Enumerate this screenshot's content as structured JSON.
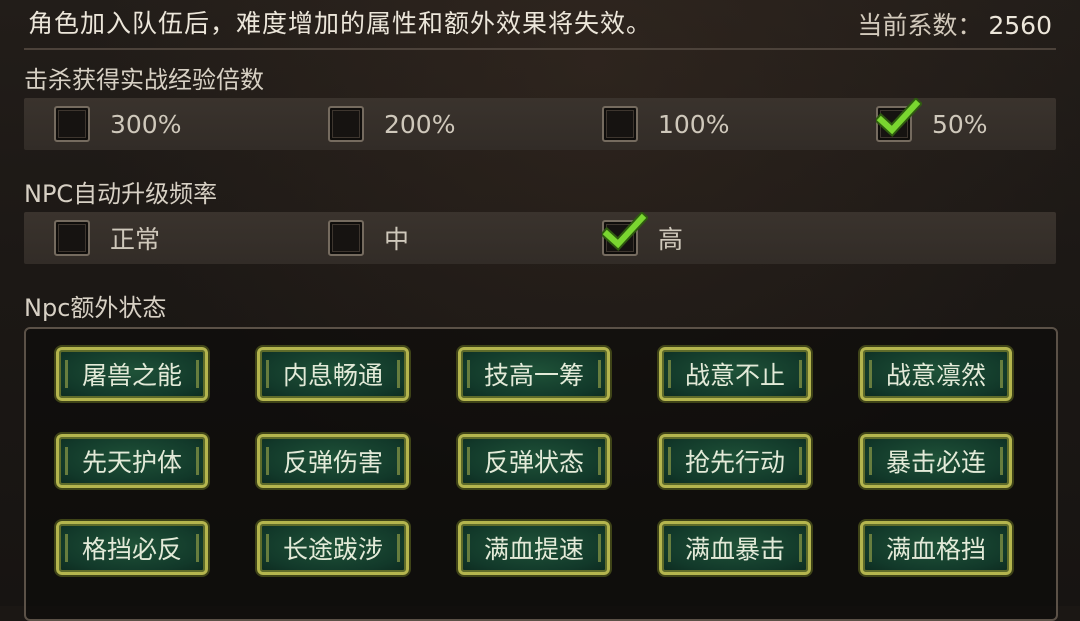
{
  "notice": "角色加入队伍后，难度增加的属性和额外效果将失效。",
  "coefficient": {
    "label": "当前系数：",
    "value": "2560"
  },
  "sections": {
    "exp": {
      "title": "击杀获得实战经验倍数",
      "options": [
        {
          "label": "300%",
          "checked": false
        },
        {
          "label": "200%",
          "checked": false
        },
        {
          "label": "100%",
          "checked": false
        },
        {
          "label": "50%",
          "checked": true
        }
      ]
    },
    "npc_level": {
      "title": "NPC自动升级频率",
      "options": [
        {
          "label": "正常",
          "checked": false
        },
        {
          "label": "中",
          "checked": false
        },
        {
          "label": "高",
          "checked": true
        }
      ]
    },
    "npc_status": {
      "title": "Npc额外状态",
      "buttons": [
        "屠兽之能",
        "内息畅通",
        "技高一筹",
        "战意不止",
        "战意凛然",
        "先天护体",
        "反弹伤害",
        "反弹状态",
        "抢先行动",
        "暴击必连",
        "格挡必反",
        "长途跋涉",
        "满血提速",
        "满血暴击",
        "满血格挡"
      ]
    }
  },
  "colors": {
    "check_green": "#7ad630",
    "button_border": "#b4b54e",
    "button_fill": "#12392a"
  }
}
